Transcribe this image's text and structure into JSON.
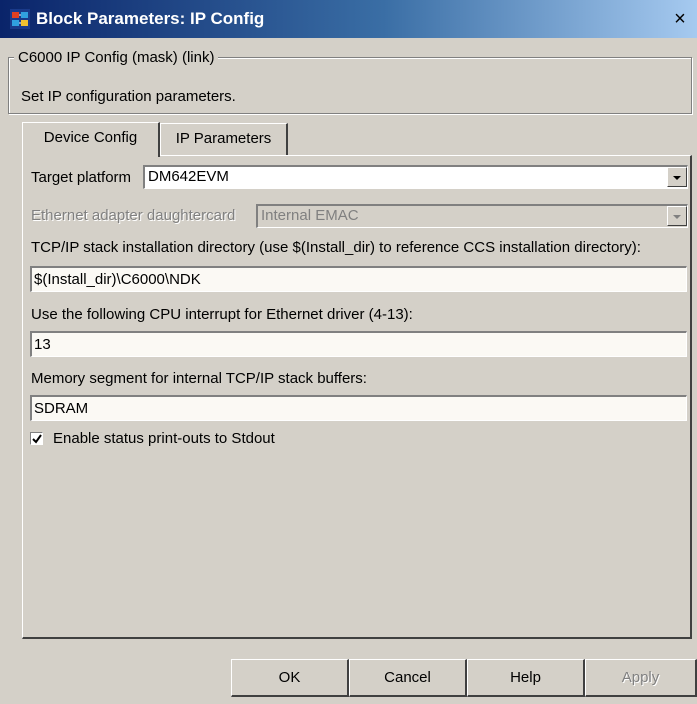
{
  "window": {
    "title": "Block Parameters: IP Config",
    "close_glyph": "×"
  },
  "group": {
    "legend": "C6000 IP Config (mask) (link)",
    "description": "Set IP configuration parameters."
  },
  "tabs": [
    {
      "label": "Device Config",
      "active": true
    },
    {
      "label": "IP Parameters",
      "active": false
    }
  ],
  "fields": {
    "target_platform": {
      "label": "Target platform",
      "value": "DM642EVM"
    },
    "ethernet_adapter": {
      "label": "Ethernet adapter daughtercard",
      "value": "Internal EMAC",
      "enabled": false
    },
    "tcpip_dir": {
      "label": "TCP/IP stack installation directory (use $(Install_dir) to reference CCS installation directory):",
      "value": "$(Install_dir)\\C6000\\NDK"
    },
    "cpu_interrupt": {
      "label": "Use the following CPU interrupt for Ethernet driver (4-13):",
      "value": "13"
    },
    "memory_segment": {
      "label": "Memory segment for internal TCP/IP stack buffers:",
      "value": "SDRAM"
    },
    "status_printouts": {
      "label": "Enable status print-outs to Stdout",
      "checked": true
    }
  },
  "buttons": {
    "ok": "OK",
    "cancel": "Cancel",
    "help": "Help",
    "apply": "Apply"
  }
}
